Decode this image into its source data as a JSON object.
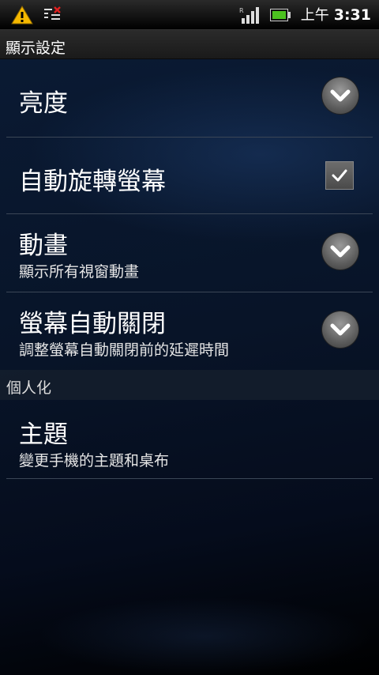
{
  "status_bar": {
    "icons": [
      "warning-icon",
      "notification-x-icon",
      "signal-icon",
      "battery-icon"
    ],
    "ampm": "上午",
    "time": "3:31"
  },
  "title_bar": {
    "title": "顯示設定"
  },
  "settings": [
    {
      "title": "亮度",
      "summary": "",
      "control": "chevron-down"
    },
    {
      "title": "自動旋轉螢幕",
      "summary": "",
      "control": "checkbox",
      "checked": true
    },
    {
      "title": "動畫",
      "summary": "顯示所有視窗動畫",
      "control": "chevron-down"
    },
    {
      "title": "螢幕自動關閉",
      "summary": "調整螢幕自動關閉前的延遲時間",
      "control": "chevron-down"
    }
  ],
  "section": {
    "title": "個人化"
  },
  "personalization": [
    {
      "title": "主題",
      "summary": "變更手機的主題和桌布"
    }
  ],
  "colors": {
    "accent_warning": "#f5b800",
    "divider": "#3b4656",
    "background": "#081428"
  }
}
